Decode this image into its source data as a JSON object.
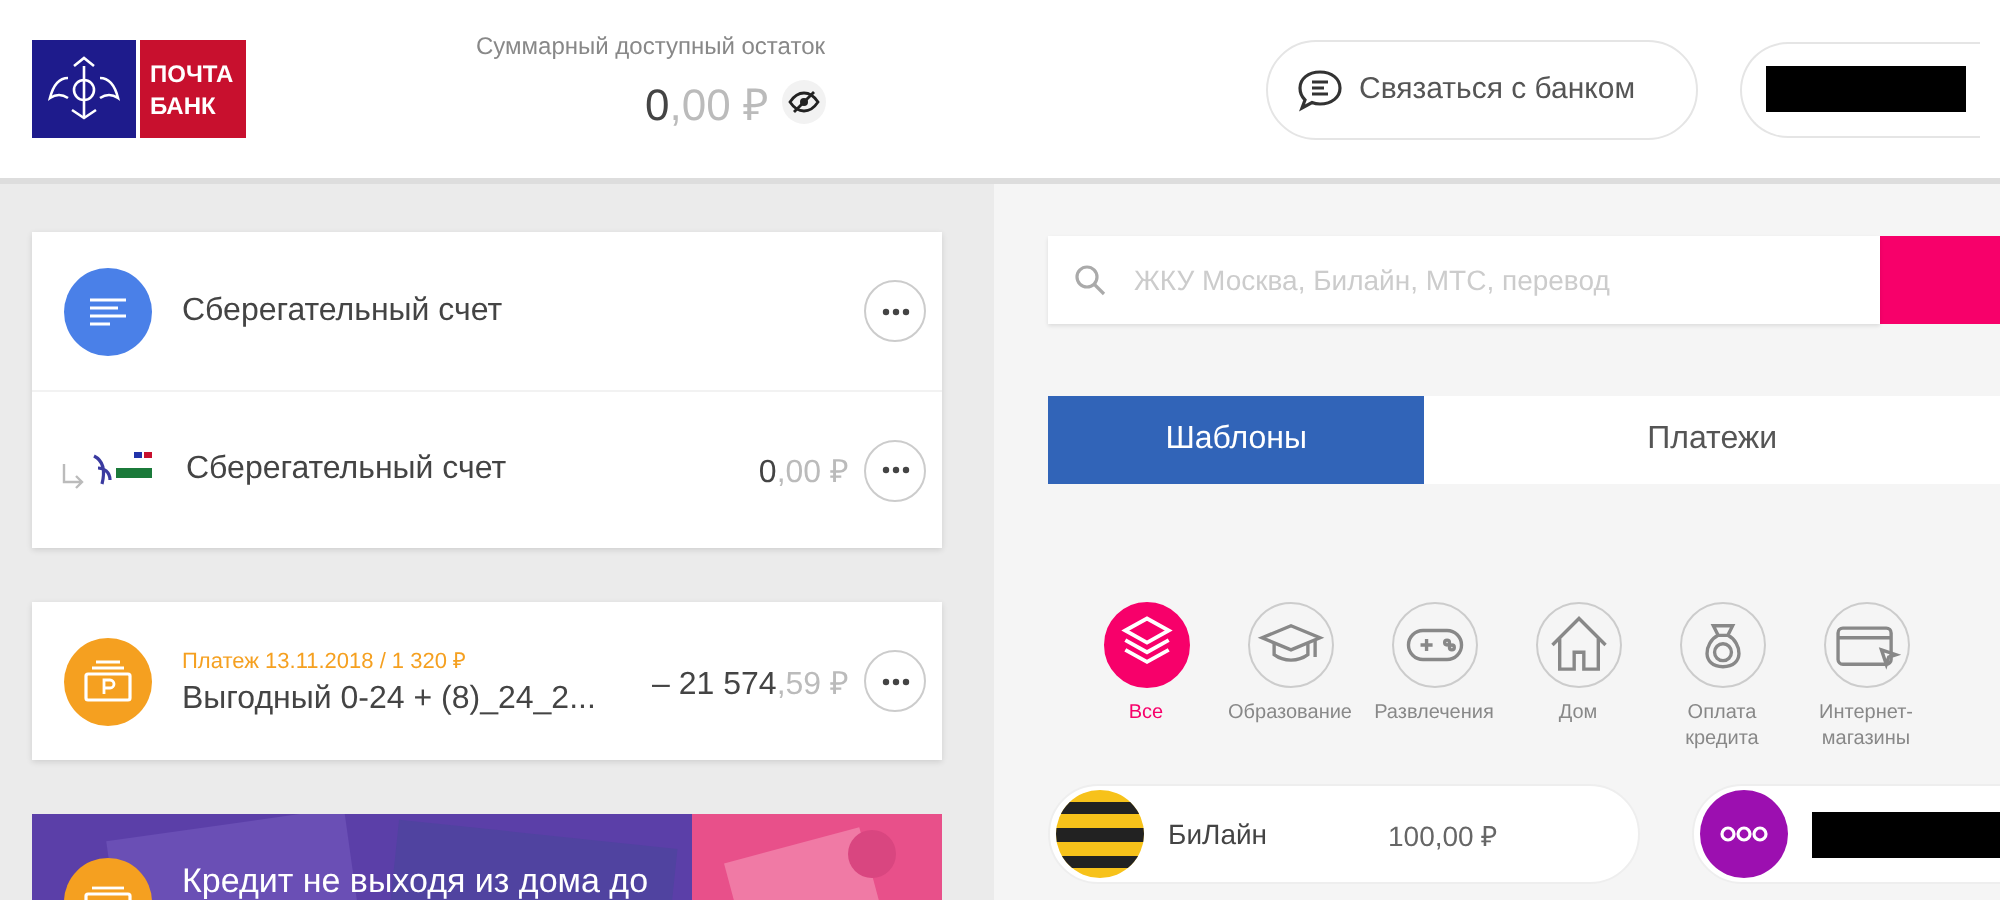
{
  "header": {
    "logo": {
      "line1": "ПОЧТА",
      "line2": "БАНК"
    },
    "balance": {
      "label": "Суммарный доступный остаток",
      "whole": "0",
      "fraction": ",00 ₽"
    },
    "contact_button": "Связаться с банком"
  },
  "account_card": {
    "rows": [
      {
        "kind": "main",
        "name": "Сберегательный счет"
      },
      {
        "kind": "card",
        "name": "Сберегательный счет",
        "whole": "0",
        "fraction": ",00 ₽"
      }
    ]
  },
  "payment_card": {
    "caption": "Платеж 13.11.2018 / 1 320 ₽",
    "name": "Выгодный 0-24 + (8)_24_2...",
    "whole": "– 21 574",
    "fraction": ",59 ₽"
  },
  "promo": {
    "text": "Кредит не выходя из дома до"
  },
  "search": {
    "placeholder": "ЖКУ Москва, Билайн, МТС, перевод"
  },
  "tabs": [
    {
      "label": "Шаблоны",
      "selected": true
    },
    {
      "label": "Платежи",
      "selected": false
    }
  ],
  "categories": [
    {
      "kind": "all",
      "label": "Все",
      "selected": true
    },
    {
      "kind": "education",
      "label": "Образование",
      "selected": false
    },
    {
      "kind": "games",
      "label": "Развлечения",
      "selected": false
    },
    {
      "kind": "home",
      "label": "Дом",
      "selected": false
    },
    {
      "kind": "credit",
      "label": "Оплата кредита",
      "selected": false
    },
    {
      "kind": "shop",
      "label": "Интернет-магазины",
      "selected": false
    }
  ],
  "templates": [
    {
      "kind": "beeline",
      "name": "БиЛайн",
      "amount": "100,00 ₽"
    },
    {
      "kind": "other",
      "redacted": true
    }
  ]
}
